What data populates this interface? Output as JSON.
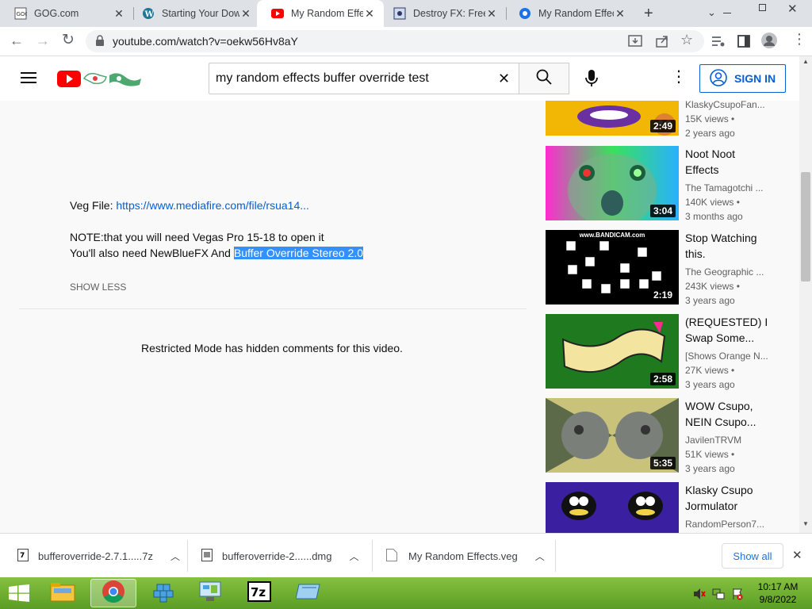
{
  "tabs": [
    {
      "title": "GOG.com",
      "icon": "gog-icon"
    },
    {
      "title": "Starting Your Dow",
      "icon": "wordpress-icon"
    },
    {
      "title": "My Random Effec",
      "icon": "youtube-icon",
      "active": true
    },
    {
      "title": "Destroy FX: Free",
      "icon": "destroyfx-icon"
    },
    {
      "title": "My Random Effec",
      "icon": "web-icon"
    }
  ],
  "address": {
    "url": "youtube.com/watch?v=oekw56Hv8aY"
  },
  "header": {
    "search_value": "my random effects buffer override test",
    "signin_label": "SIGN IN"
  },
  "description": {
    "veg_label": "Veg File: ",
    "veg_link": "https://www.mediafire.com/file/rsua14...",
    "note_line": "NOTE:that you will need Vegas Pro 15-18 to open it",
    "need_prefix": "You'll also need NewBlueFX And ",
    "need_highlight": "Buffer Override Stereo 2.0",
    "show_less": "SHOW LESS"
  },
  "comments_notice": "Restricted Mode has hidden comments for this video.",
  "sidebar": [
    {
      "title": "",
      "channel": "KlaskyCsupoFan...",
      "views": "15K views",
      "age": "2 years ago",
      "duration": "2:49"
    },
    {
      "title": "Noot Noot Effects",
      "channel": "The Tamagotchi ...",
      "views": "140K views",
      "age": "3 months ago",
      "duration": "3:04"
    },
    {
      "title": "Stop Watching this.",
      "channel": "The Geographic ...",
      "views": "243K views",
      "age": "3 years ago",
      "duration": "2:19"
    },
    {
      "title": "(REQUESTED) I Swap Some...",
      "channel": "[Shows Orange N...",
      "views": "27K views",
      "age": "3 years ago",
      "duration": "2:58"
    },
    {
      "title": "WOW Csupo, NEIN Csupo...",
      "channel": "JavilenTRVM",
      "views": "51K views",
      "age": "3 years ago",
      "duration": "5:35"
    },
    {
      "title": "Klasky Csupo Jormulator",
      "channel": "RandomPerson7...",
      "views": "",
      "age": "",
      "duration": ""
    }
  ],
  "bandicam_text": "www.BANDICAM.com",
  "downloads": [
    {
      "name": "bufferoverride-2.7.1.....7z"
    },
    {
      "name": "bufferoverride-2......dmg"
    },
    {
      "name": "My Random Effects.veg"
    }
  ],
  "show_all": "Show all",
  "clock": {
    "time": "10:17 AM",
    "date": "9/8/2022"
  },
  "colors": {
    "yt_red": "#ff0000",
    "link_blue": "#065fd4",
    "taskbar_green": "#6fae2f"
  }
}
